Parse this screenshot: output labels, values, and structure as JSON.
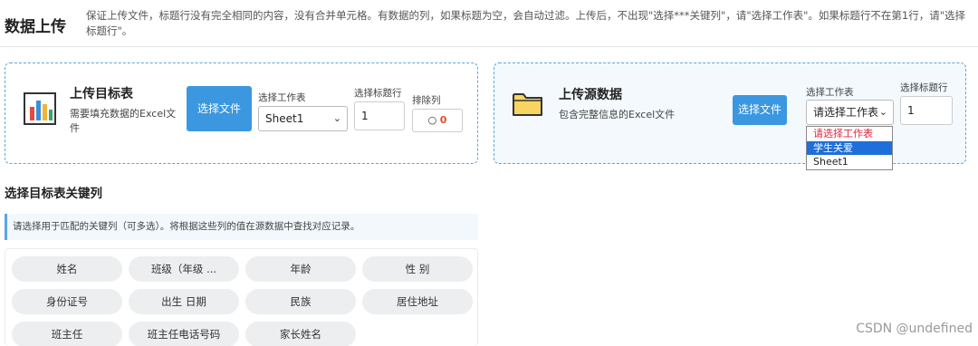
{
  "header": {
    "title": "数据上传",
    "instructions": "保证上传文件，标题行没有完全相同的内容，没有合并单元格。有数据的列，如果标题为空，会自动过滤。上传后，不出现\"选择***关键列\"，请\"选择工作表\"。如果标题行不在第1行，请\"选择标题行\"。"
  },
  "target_panel": {
    "icon": "bar-chart-icon",
    "title": "上传目标表",
    "description": "需要填充数据的Excel文件",
    "file_button": "选择文件",
    "sheet_label": "选择工作表",
    "sheet_value": "Sheet1",
    "header_row_label": "选择标题行",
    "header_row_value": "1",
    "exclude_label": "排除列",
    "exclude_count": "0"
  },
  "source_panel": {
    "icon": "folder-icon",
    "title": "上传源数据",
    "description": "包含完整信息的Excel文件",
    "file_button": "选择文件",
    "sheet_label": "选择工作表",
    "sheet_value": "请选择工作表",
    "header_row_label": "选择标题行",
    "header_row_value": "1",
    "sheet_options": [
      "请选择工作表",
      "学生关爱",
      "Sheet1"
    ]
  },
  "key_section": {
    "title": "选择目标表关键列",
    "info": "请选择用于匹配的关键列（可多选）。将根据这些列的值在源数据中查找对应记录。",
    "columns": [
      "姓名",
      "班级（年级 ...",
      "年龄",
      "性 别",
      "身份证号",
      "出生 日期",
      "民族",
      "居住地址",
      "班主任",
      "班主任电话号码",
      "家长姓名"
    ]
  },
  "watermark": "CSDN @undefined",
  "colors": {
    "accent": "#3b97e0",
    "dashed_border": "#5aa6e0",
    "placeholder_red": "#e0263c",
    "selected_blue": "#1e6fd9",
    "chip_bg": "#eceef0"
  }
}
